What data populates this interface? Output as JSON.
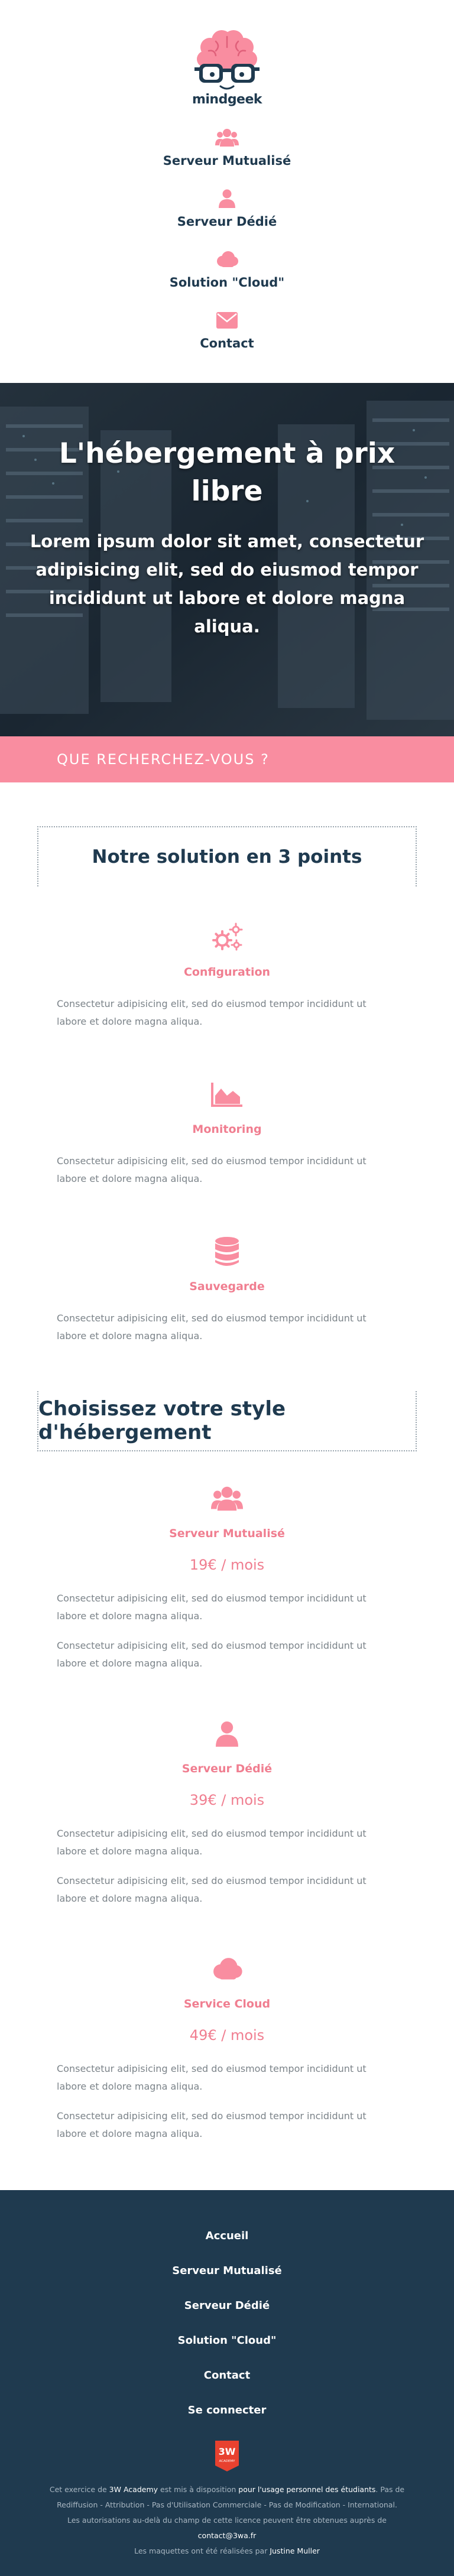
{
  "brand": {
    "name": "mindgeek",
    "colors": {
      "accent": "#f98da0",
      "accent_dark": "#f07e90",
      "navy": "#1f3a4f"
    }
  },
  "nav": {
    "items": [
      {
        "label": "Serveur Mutualisé",
        "icon": "users-icon"
      },
      {
        "label": "Serveur Dédié",
        "icon": "user-icon"
      },
      {
        "label": "Solution \"Cloud\"",
        "icon": "cloud-icon"
      },
      {
        "label": "Contact",
        "icon": "envelope-icon"
      }
    ]
  },
  "hero": {
    "title": "L'hébergement à prix libre",
    "subtitle": "Lorem ipsum dolor sit amet, consectetur adipisicing elit, sed do eiusmod tempor incididunt ut labore et dolore magna aliqua."
  },
  "search": {
    "placeholder": "QUE RECHERCHEZ-VOUS ?"
  },
  "solution": {
    "title": "Notre solution en 3 points",
    "items": [
      {
        "title": "Configuration",
        "icon": "gears-icon",
        "text": "Consectetur adipisicing elit, sed do eiusmod tempor incididunt ut labore et dolore magna aliqua."
      },
      {
        "title": "Monitoring",
        "icon": "area-chart-icon",
        "text": "Consectetur adipisicing elit, sed do eiusmod tempor incididunt ut labore et dolore magna aliqua."
      },
      {
        "title": "Sauvegarde",
        "icon": "database-icon",
        "text": "Consectetur adipisicing elit, sed do eiusmod tempor incididunt ut labore et dolore magna aliqua."
      }
    ]
  },
  "hosting": {
    "title": "Choisissez votre style d'hébergement",
    "plans": [
      {
        "title": "Serveur Mutualisé",
        "icon": "users-icon",
        "price": "19€ / mois",
        "text1": "Consectetur adipisicing elit, sed do eiusmod tempor incididunt ut labore et dolore magna aliqua.",
        "text2": "Consectetur adipisicing elit, sed do eiusmod tempor incididunt ut labore et dolore magna aliqua."
      },
      {
        "title": "Serveur Dédié",
        "icon": "user-icon",
        "price": "39€ / mois",
        "text1": "Consectetur adipisicing elit, sed do eiusmod tempor incididunt ut labore et dolore magna aliqua.",
        "text2": "Consectetur adipisicing elit, sed do eiusmod tempor incididunt ut labore et dolore magna aliqua."
      },
      {
        "title": "Service Cloud",
        "icon": "cloud-icon",
        "price": "49€ / mois",
        "text1": "Consectetur adipisicing elit, sed do eiusmod tempor incididunt ut labore et dolore magna aliqua.",
        "text2": "Consectetur adipisicing elit, sed do eiusmod tempor incididunt ut labore et dolore magna aliqua."
      }
    ]
  },
  "footer": {
    "links": [
      "Accueil",
      "Serveur Mutualisé",
      "Serveur Dédié",
      "Solution \"Cloud\"",
      "Contact",
      "Se connecter"
    ],
    "badge": "3W ACADEMY",
    "line1_a": "Cet exercice de ",
    "line1_b": "3W Academy",
    "line1_c": " est mis à disposition ",
    "line1_d": "pour l'usage personnel des étudiants",
    "line1_e": ". Pas de Rediffusion - Attribution - Pas d'Utilisation Commerciale - Pas de Modification - International.",
    "line2_a": "Les autorisations au-delà du champ de cette licence peuvent être obtenues auprès de ",
    "line2_b": "contact@3wa.fr",
    "line3_a": "Les maquettes ont été réalisées par ",
    "line3_b": "Justine Muller"
  }
}
